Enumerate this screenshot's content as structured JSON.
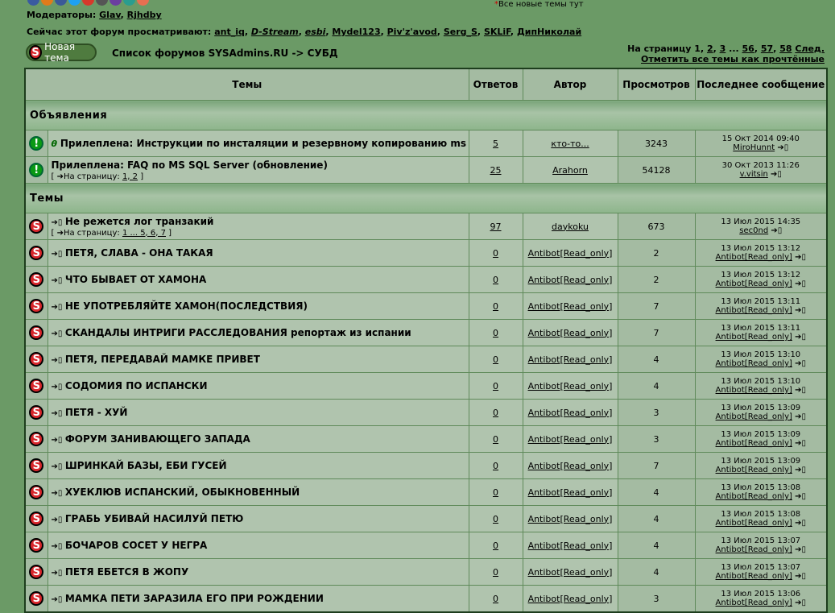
{
  "header": {
    "moderators_label": "Модераторы:",
    "moderators": [
      "Glav",
      "Rjhdby"
    ],
    "viewers_label": "Сейчас этот форум просматривают:",
    "viewers": [
      "ant_iq",
      "D-Stream",
      "esbi",
      "Mydel123",
      "Piv'z'avod",
      "Serg_S",
      "SKLiF",
      "ДипНиколай"
    ],
    "new_topics_note": "Все новые темы тут",
    "new_topic_button": "Новая тема",
    "breadcrumb": "Список форумов SYSAdmins.RU -> СУБД",
    "pager": {
      "label": "На страницу",
      "pages": [
        "1",
        "2",
        "3",
        "...",
        "56",
        "57",
        "58"
      ],
      "next": "След.",
      "mark_read": "Отметить все темы как прочтённые"
    }
  },
  "table": {
    "columns": [
      "Темы",
      "Ответов",
      "Автор",
      "Просмотров",
      "Последнее сообщение"
    ],
    "section_announcements": "Объявления",
    "section_topics": "Темы",
    "announcements": [
      {
        "title": "Прилеплена: Инструкции по инсталяции и резервному копированию ms sql",
        "replies": "5",
        "author": "кто-то...",
        "views": "3243",
        "last_date": "15 Окт 2014 09:40",
        "last_user": "MiroHunnt",
        "pages_label": "",
        "pages": ""
      },
      {
        "title": "Прилеплена: FAQ по MS SQL Server (обновление)",
        "replies": "25",
        "author": "Arahorn",
        "views": "54128",
        "last_date": "30 Окт 2013 11:26",
        "last_user": "v.vitsin",
        "pages_label": "На страницу:",
        "pages": "1, 2"
      }
    ],
    "topics": [
      {
        "title": "Не режется лог транзакий",
        "replies": "97",
        "author": "daykoku",
        "views": "673",
        "last_date": "13 Июл 2015 14:35",
        "last_user": "sec0nd",
        "pages_label": "На страницу:",
        "pages": "1 ... 5, 6, 7"
      },
      {
        "title": "ПЕТЯ, СЛАВА - ОНА ТАКАЯ",
        "replies": "0",
        "author": "Antibot[Read_only]",
        "views": "2",
        "last_date": "13 Июл 2015 13:12",
        "last_user": "Antibot[Read_only]"
      },
      {
        "title": "ЧТО БЫВАЕТ ОТ ХАМОНА",
        "replies": "0",
        "author": "Antibot[Read_only]",
        "views": "2",
        "last_date": "13 Июл 2015 13:12",
        "last_user": "Antibot[Read_only]"
      },
      {
        "title": "НЕ УПОТРЕБЛЯЙТЕ ХАМОН(ПОСЛЕДСТВИЯ)",
        "replies": "0",
        "author": "Antibot[Read_only]",
        "views": "7",
        "last_date": "13 Июл 2015 13:11",
        "last_user": "Antibot[Read_only]"
      },
      {
        "title": "СКАНДАЛЫ ИНТРИГИ РАССЛЕДОВАНИЯ репортаж из испании",
        "replies": "0",
        "author": "Antibot[Read_only]",
        "views": "7",
        "last_date": "13 Июл 2015 13:11",
        "last_user": "Antibot[Read_only]"
      },
      {
        "title": "ПЕТЯ, ПЕРЕДАВАЙ МАМКЕ ПРИВЕТ",
        "replies": "0",
        "author": "Antibot[Read_only]",
        "views": "4",
        "last_date": "13 Июл 2015 13:10",
        "last_user": "Antibot[Read_only]"
      },
      {
        "title": "СОДОМИЯ ПО ИСПАНСКИ",
        "replies": "0",
        "author": "Antibot[Read_only]",
        "views": "4",
        "last_date": "13 Июл 2015 13:10",
        "last_user": "Antibot[Read_only]"
      },
      {
        "title": "ПЕТЯ - ХУЙ",
        "replies": "0",
        "author": "Antibot[Read_only]",
        "views": "3",
        "last_date": "13 Июл 2015 13:09",
        "last_user": "Antibot[Read_only]"
      },
      {
        "title": "ФОРУМ ЗАНИВАЮЩЕГО ЗАПАДА",
        "replies": "0",
        "author": "Antibot[Read_only]",
        "views": "3",
        "last_date": "13 Июл 2015 13:09",
        "last_user": "Antibot[Read_only]"
      },
      {
        "title": "ШРИНКАЙ БАЗЫ, ЕБИ ГУСЕЙ",
        "replies": "0",
        "author": "Antibot[Read_only]",
        "views": "7",
        "last_date": "13 Июл 2015 13:09",
        "last_user": "Antibot[Read_only]"
      },
      {
        "title": "ХУЕКЛЮВ ИСПАНСКИЙ, ОБЫКНОВЕННЫЙ",
        "replies": "0",
        "author": "Antibot[Read_only]",
        "views": "4",
        "last_date": "13 Июл 2015 13:08",
        "last_user": "Antibot[Read_only]"
      },
      {
        "title": "ГРАБЬ УБИВАЙ НАСИЛУЙ ПЕТЮ",
        "replies": "0",
        "author": "Antibot[Read_only]",
        "views": "4",
        "last_date": "13 Июл 2015 13:08",
        "last_user": "Antibot[Read_only]"
      },
      {
        "title": "БОЧАРОВ СОСЕТ У НЕГРА",
        "replies": "0",
        "author": "Antibot[Read_only]",
        "views": "4",
        "last_date": "13 Июл 2015 13:07",
        "last_user": "Antibot[Read_only]"
      },
      {
        "title": "ПЕТЯ ЕБЕТСЯ В ЖОПУ",
        "replies": "0",
        "author": "Antibot[Read_only]",
        "views": "4",
        "last_date": "13 Июл 2015 13:07",
        "last_user": "Antibot[Read_only]"
      },
      {
        "title": "МАМКА ПЕТИ ЗАРАЗИЛА ЕГО ПРИ РОЖДЕНИИ",
        "replies": "0",
        "author": "Antibot[Read_only]",
        "views": "3",
        "last_date": "13 Июл 2015 13:06",
        "last_user": "Antibot[Read_only]"
      }
    ]
  },
  "colors": {
    "page_bg": "#6b9a66",
    "row_bg": "#b0c4ae",
    "logo_red": "#d8262b",
    "sticky_green": "#0a9a14"
  },
  "icons": {
    "topic": "s-logo-icon",
    "sticky": "exclamation-icon",
    "goto_last": "goto-post-icon",
    "new_post": "new-post-icon"
  }
}
